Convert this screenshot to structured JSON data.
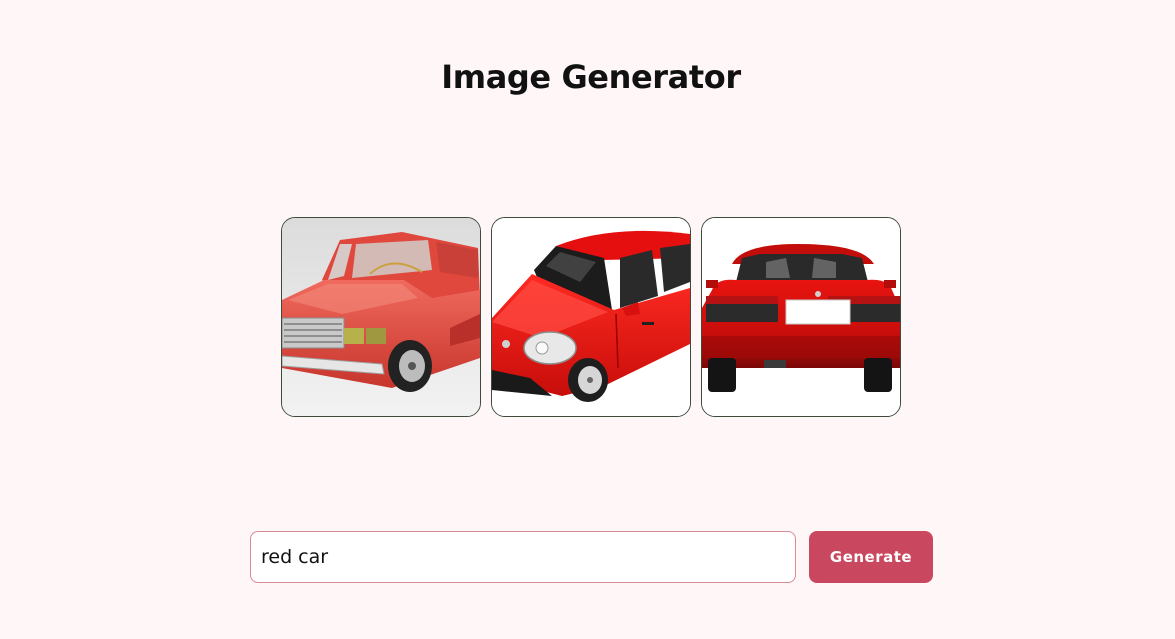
{
  "header": {
    "title": "Image Generator"
  },
  "gallery": {
    "images": [
      {
        "subject": "red-toy-car-front-angle"
      },
      {
        "subject": "red-hatchback-3d-front"
      },
      {
        "subject": "red-car-rear-view"
      }
    ]
  },
  "prompt": {
    "value": "red car"
  },
  "actions": {
    "generate_label": "Generate"
  },
  "colors": {
    "background": "#fff6f8",
    "accent": "#c9485f",
    "input_border": "#d98a95",
    "card_border": "#3d4a3a"
  }
}
